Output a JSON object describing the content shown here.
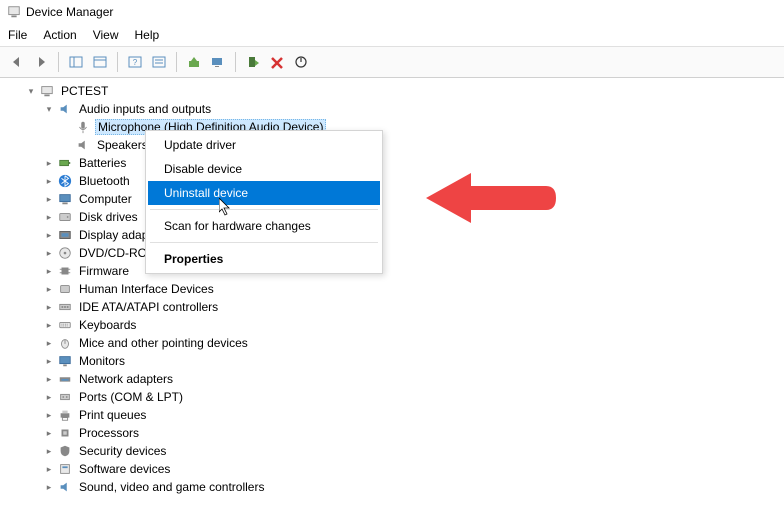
{
  "app": {
    "title": "Device Manager"
  },
  "menu": {
    "file": "File",
    "action": "Action",
    "view": "View",
    "help": "Help"
  },
  "tree": {
    "root": "PCTEST",
    "audio_category": "Audio inputs and outputs",
    "microphone": "Microphone (High Definition Audio Device)",
    "speakers": "Speakers",
    "batteries": "Batteries",
    "bluetooth": "Bluetooth",
    "computer": "Computer",
    "disk_drives": "Disk drives",
    "display_adapters": "Display adap",
    "dvd": "DVD/CD-ROM",
    "firmware": "Firmware",
    "hid": "Human Interface Devices",
    "ide": "IDE ATA/ATAPI controllers",
    "keyboards": "Keyboards",
    "mice": "Mice and other pointing devices",
    "monitors": "Monitors",
    "network": "Network adapters",
    "ports": "Ports (COM & LPT)",
    "print_queues": "Print queues",
    "processors": "Processors",
    "security": "Security devices",
    "software": "Software devices",
    "sound": "Sound, video and game controllers"
  },
  "context_menu": {
    "update_driver": "Update driver",
    "disable_device": "Disable device",
    "uninstall_device": "Uninstall device",
    "scan": "Scan for hardware changes",
    "properties": "Properties"
  }
}
